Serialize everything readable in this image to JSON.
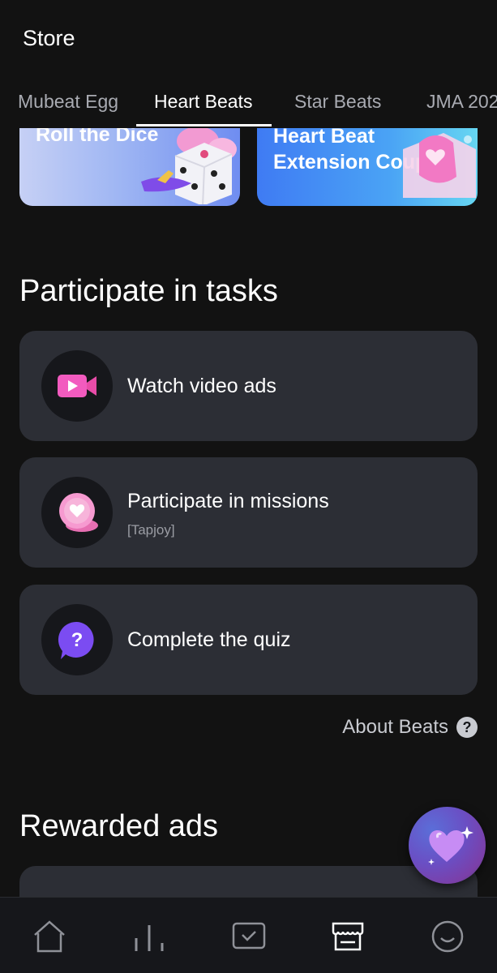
{
  "header": {
    "title": "Store"
  },
  "tabs": [
    {
      "label": "Mubeat Egg",
      "active": false
    },
    {
      "label": "Heart Beats",
      "active": true
    },
    {
      "label": "Star Beats",
      "active": false
    },
    {
      "label": "JMA 202",
      "active": false
    }
  ],
  "banners": [
    {
      "text": "Roll the Dice"
    },
    {
      "text_line1": "Heart Beat",
      "text_line2": "Extension Coupon"
    }
  ],
  "participate": {
    "title": "Participate in tasks",
    "tasks": [
      {
        "label": "Watch video ads",
        "icon": "video-camera-icon"
      },
      {
        "label": "Participate in missions",
        "sub": "[Tapjoy]",
        "icon": "heart-coin-icon"
      },
      {
        "label": "Complete the quiz",
        "icon": "quiz-bubble-icon"
      }
    ]
  },
  "about": {
    "label": "About Beats",
    "icon": "question-circle-icon"
  },
  "rewarded": {
    "title": "Rewarded ads"
  },
  "fab": {
    "icon": "sparkle-heart-icon"
  },
  "bottom_nav": [
    {
      "name": "home",
      "icon": "home-icon"
    },
    {
      "name": "chart",
      "icon": "chart-icon"
    },
    {
      "name": "vote",
      "icon": "vote-check-icon"
    },
    {
      "name": "store",
      "icon": "store-icon",
      "active": true
    },
    {
      "name": "profile",
      "icon": "smile-icon"
    }
  ],
  "colors": {
    "background": "#121212",
    "card": "#2c2e35",
    "accent_pink": "#f25bbf",
    "accent_purple": "#7b4cf2"
  }
}
